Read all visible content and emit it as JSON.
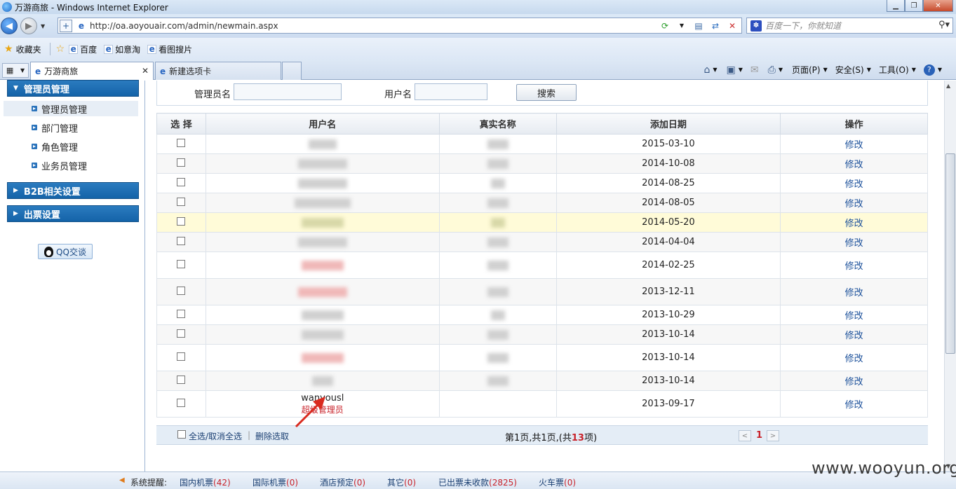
{
  "window": {
    "title": "万游商旅 - Windows Internet Explorer"
  },
  "address": {
    "url": "http://oa.aoyouair.com/admin/newmain.aspx",
    "search_placeholder": "百度一下，你就知道"
  },
  "favorites": {
    "label": "收藏夹",
    "items": [
      "百度",
      "如意淘",
      "看图搜片"
    ]
  },
  "tabs": [
    {
      "label": "万游商旅"
    },
    {
      "label": "新建选项卡"
    }
  ],
  "commands": {
    "page": "页面(P)",
    "safety": "安全(S)",
    "tools": "工具(O)"
  },
  "sidebar": {
    "groups": [
      {
        "label": "管理员管理",
        "items": [
          "管理员管理",
          "部门管理",
          "角色管理",
          "业务员管理"
        ]
      },
      {
        "label": "B2B相关设置"
      },
      {
        "label": "出票设置"
      }
    ],
    "qq": "QQ交谈"
  },
  "search": {
    "admin_label": "管理员名",
    "user_label": "用户名",
    "button": "搜索"
  },
  "table": {
    "headers": [
      "选 择",
      "用户名",
      "真实名称",
      "添加日期",
      "操作"
    ],
    "edit_label": "修改",
    "rows": [
      {
        "date": "2015-03-10"
      },
      {
        "date": "2014-10-08"
      },
      {
        "date": "2014-08-25"
      },
      {
        "date": "2014-08-05"
      },
      {
        "date": "2014-05-20"
      },
      {
        "date": "2014-04-04"
      },
      {
        "date": "2014-02-25"
      },
      {
        "date": "2013-12-11"
      },
      {
        "date": "2013-10-29"
      },
      {
        "date": "2013-10-14"
      },
      {
        "date": "2013-10-14"
      },
      {
        "date": "2013-10-14"
      },
      {
        "date": "2013-09-17",
        "username": "wanyousl",
        "role": "超级管理员"
      }
    ]
  },
  "footer": {
    "select_all": "全选/取消全选",
    "delete_selected": "删除选取",
    "page_prefix": "第1页,共1页,(共",
    "total": "13",
    "page_suffix": "项)",
    "current_page": "1"
  },
  "status": {
    "label": "系统提醒:",
    "items": [
      {
        "name": "国内机票",
        "count": "(42)"
      },
      {
        "name": "国际机票",
        "count": "(0)"
      },
      {
        "name": "酒店预定",
        "count": "(0)"
      },
      {
        "name": "其它",
        "count": "(0)"
      },
      {
        "name": "已出票未收款",
        "count": "(2825)"
      },
      {
        "name": "火车票",
        "count": "(0)"
      }
    ]
  },
  "watermark": "www.wooyun.org"
}
